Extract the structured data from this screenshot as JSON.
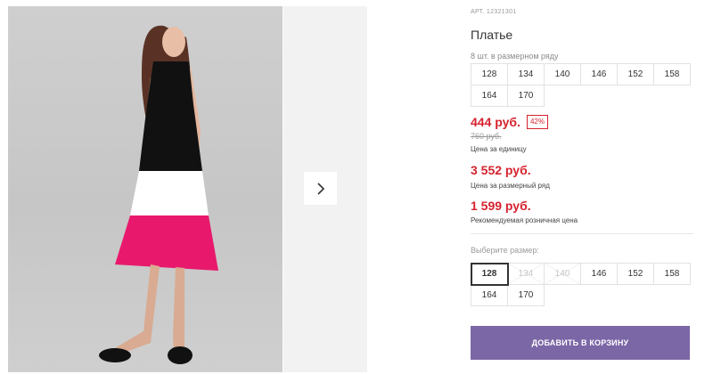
{
  "gallery": {
    "next_icon": "chevron-right-icon"
  },
  "product": {
    "article": "АРТ. 12321301",
    "title": "Платье",
    "row_note": "8 шт. в размерном ряду",
    "size_row": [
      "128",
      "134",
      "140",
      "146",
      "152",
      "158",
      "164",
      "170"
    ],
    "price": "444 руб.",
    "discount": "42%",
    "old_price": "760 руб.",
    "unit_label": "Цена за единицу",
    "row_price": "3 552 руб.",
    "row_price_label": "Цена за размерный ряд",
    "recommended_price": "1 599 руб.",
    "recommended_label": "Рекомендуемая розничная цена",
    "choose_label": "Выберите размер:",
    "sizes": [
      {
        "label": "128",
        "state": "selected"
      },
      {
        "label": "134",
        "state": "disabled"
      },
      {
        "label": "140",
        "state": "disabled"
      },
      {
        "label": "146",
        "state": "available"
      },
      {
        "label": "152",
        "state": "available"
      },
      {
        "label": "158",
        "state": "available"
      },
      {
        "label": "164",
        "state": "available"
      },
      {
        "label": "170",
        "state": "available"
      }
    ],
    "add_to_cart": "ДОБАВИТЬ В КОРЗИНУ"
  },
  "colors": {
    "accent": "#7b66a6",
    "price": "#d5232f",
    "dress_top": "#111111",
    "dress_middle": "#ffffff",
    "dress_bottom": "#e8196c"
  }
}
